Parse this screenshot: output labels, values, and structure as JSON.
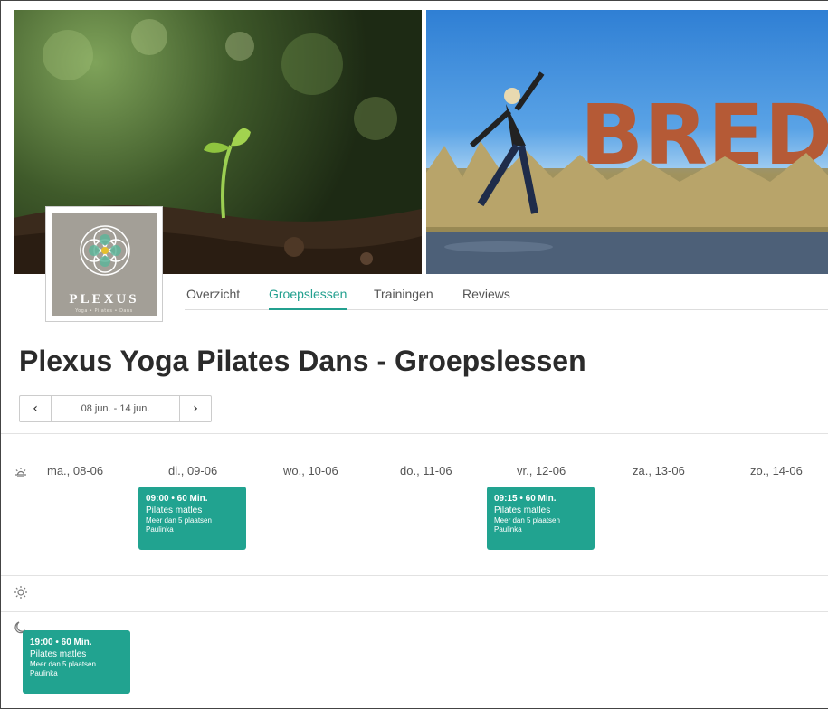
{
  "logo": {
    "word": "PLEXUS",
    "tagline": "Yoga • Pilates • Dans"
  },
  "hero": {
    "right_sign_text": "BREDA"
  },
  "tabs": [
    {
      "label": "Overzicht",
      "active": false
    },
    {
      "label": "Groepslessen",
      "active": true
    },
    {
      "label": "Trainingen",
      "active": false
    },
    {
      "label": "Reviews",
      "active": false
    }
  ],
  "page_title": "Plexus Yoga Pilates Dans - Groepslessen",
  "week_picker": {
    "prev_icon": "‹",
    "label": "08 jun. - 14 jun.",
    "next_icon": "›"
  },
  "days": [
    "ma., 08-06",
    "di., 09-06",
    "wo., 10-06",
    "do., 11-06",
    "vr., 12-06",
    "za., 13-06",
    "zo., 14-06"
  ],
  "period_icons": [
    "sunrise-icon",
    "sun-icon",
    "moon-icon"
  ],
  "classes": [
    {
      "time": "09:00 • 60 Min.",
      "name": "Pilates matles",
      "availability": "Meer dan 5 plaatsen",
      "teacher": "Paulinka"
    },
    {
      "time": "09:15 • 60 Min.",
      "name": "Pilates matles",
      "availability": "Meer dan 5 plaatsen",
      "teacher": "Paulinka"
    },
    {
      "time": "19:00 • 60 Min.",
      "name": "Pilates matles",
      "availability": "Meer dan 5 plaatsen",
      "teacher": "Paulinka"
    }
  ],
  "colors": {
    "accent": "#23a08f",
    "card": "#21a390"
  }
}
